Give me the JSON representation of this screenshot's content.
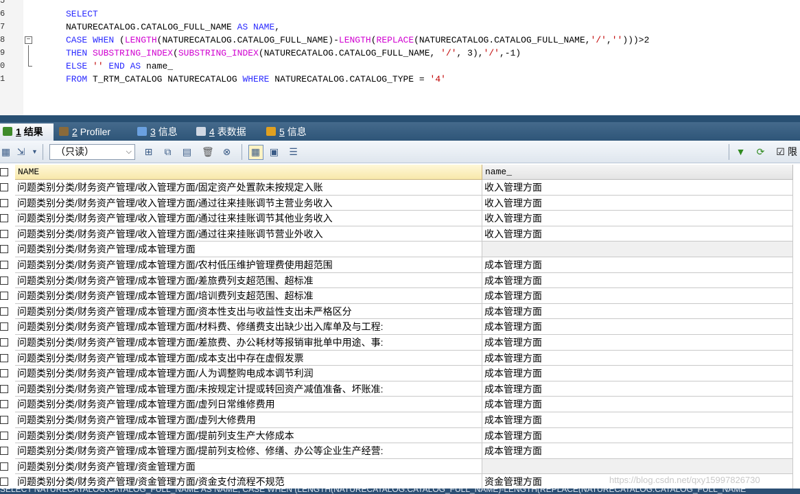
{
  "editor": {
    "lines": [
      {
        "num": "5",
        "segments": []
      },
      {
        "num": "6",
        "segments": [
          {
            "t": "SELECT",
            "c": "kw"
          }
        ]
      },
      {
        "num": "7",
        "segments": [
          {
            "t": "NATURECATALOG.CATALOG_FULL_NAME ",
            "c": "tx"
          },
          {
            "t": "AS NAME",
            "c": "kw"
          },
          {
            "t": ",",
            "c": "tx"
          }
        ]
      },
      {
        "num": "8",
        "fold": "−",
        "segments": [
          {
            "t": "CASE WHEN ",
            "c": "kw"
          },
          {
            "t": "(",
            "c": "tx"
          },
          {
            "t": "LENGTH",
            "c": "fn"
          },
          {
            "t": "(NATURECATALOG.CATALOG_FULL_NAME)-",
            "c": "tx"
          },
          {
            "t": "LENGTH",
            "c": "fn"
          },
          {
            "t": "(",
            "c": "tx"
          },
          {
            "t": "REPLACE",
            "c": "fn"
          },
          {
            "t": "(NATURECATALOG.CATALOG_FULL_NAME,",
            "c": "tx"
          },
          {
            "t": "'/'",
            "c": "st"
          },
          {
            "t": ",",
            "c": "tx"
          },
          {
            "t": "''",
            "c": "st"
          },
          {
            "t": ")))>2",
            "c": "tx"
          }
        ]
      },
      {
        "num": "9",
        "segments": [
          {
            "t": "THEN ",
            "c": "kw"
          },
          {
            "t": "SUBSTRING_INDEX",
            "c": "fn"
          },
          {
            "t": "(",
            "c": "tx"
          },
          {
            "t": "SUBSTRING_INDEX",
            "c": "fn"
          },
          {
            "t": "(NATURECATALOG.CATALOG_FULL_NAME, ",
            "c": "tx"
          },
          {
            "t": "'/'",
            "c": "st"
          },
          {
            "t": ", 3),",
            "c": "tx"
          },
          {
            "t": "'/'",
            "c": "st"
          },
          {
            "t": ",-1)",
            "c": "tx"
          }
        ]
      },
      {
        "num": "0",
        "segments": [
          {
            "t": "ELSE ",
            "c": "kw"
          },
          {
            "t": "''",
            "c": "st"
          },
          {
            "t": " END AS ",
            "c": "kw"
          },
          {
            "t": "name_",
            "c": "tx"
          }
        ]
      },
      {
        "num": "1",
        "segments": [
          {
            "t": "FROM ",
            "c": "kw"
          },
          {
            "t": "T_RTM_CATALOG NATURECATALOG ",
            "c": "tx"
          },
          {
            "t": "WHERE ",
            "c": "kw"
          },
          {
            "t": "NATURECATALOG.CATALOG_TYPE = ",
            "c": "tx"
          },
          {
            "t": "'4'",
            "c": "st"
          }
        ]
      }
    ]
  },
  "tabs": [
    {
      "num": "1",
      "label": "结果",
      "icon": "result-grid-icon",
      "active": true
    },
    {
      "num": "2",
      "label": "Profiler",
      "icon": "profiler-icon",
      "active": false
    },
    {
      "num": "3",
      "label": "信息",
      "icon": "info-icon",
      "active": false
    },
    {
      "num": "4",
      "label": "表数据",
      "icon": "table-data-icon",
      "active": false
    },
    {
      "num": "5",
      "label": "信息",
      "icon": "info-chart-icon",
      "active": false
    }
  ],
  "toolbar": {
    "readonly_select": "（只读）",
    "limit_label": "限",
    "limit_checked": true
  },
  "grid": {
    "headers": [
      "NAME",
      "name_"
    ],
    "rows": [
      [
        "问题类别分类/财务资产管理/收入管理方面/固定资产处置款未按规定入账",
        "收入管理方面"
      ],
      [
        "问题类别分类/财务资产管理/收入管理方面/通过往来挂账调节主营业务收入",
        "收入管理方面"
      ],
      [
        "问题类别分类/财务资产管理/收入管理方面/通过往来挂账调节其他业务收入",
        "收入管理方面"
      ],
      [
        "问题类别分类/财务资产管理/收入管理方面/通过往来挂账调节营业外收入",
        "收入管理方面"
      ],
      [
        "问题类别分类/财务资产管理/成本管理方面",
        ""
      ],
      [
        "问题类别分类/财务资产管理/成本管理方面/农村低压维护管理费使用超范围",
        "成本管理方面"
      ],
      [
        "问题类别分类/财务资产管理/成本管理方面/差旅费列支超范围、超标准",
        "成本管理方面"
      ],
      [
        "问题类别分类/财务资产管理/成本管理方面/培训费列支超范围、超标准",
        "成本管理方面"
      ],
      [
        "问题类别分类/财务资产管理/成本管理方面/资本性支出与收益性支出未严格区分",
        "成本管理方面"
      ],
      [
        "问题类别分类/财务资产管理/成本管理方面/材料费、修缮费支出缺少出入库单及与工程:",
        "成本管理方面"
      ],
      [
        "问题类别分类/财务资产管理/成本管理方面/差旅费、办公耗材等报销审批单中用途、事:",
        "成本管理方面"
      ],
      [
        "问题类别分类/财务资产管理/成本管理方面/成本支出中存在虚假发票",
        "成本管理方面"
      ],
      [
        "问题类别分类/财务资产管理/成本管理方面/人为调整购电成本调节利润",
        "成本管理方面"
      ],
      [
        "问题类别分类/财务资产管理/成本管理方面/未按规定计提或转回资产减值准备、坏账准:",
        "成本管理方面"
      ],
      [
        "问题类别分类/财务资产管理/成本管理方面/虚列日常维修费用",
        "成本管理方面"
      ],
      [
        "问题类别分类/财务资产管理/成本管理方面/虚列大修费用",
        "成本管理方面"
      ],
      [
        "问题类别分类/财务资产管理/成本管理方面/提前列支生产大修成本",
        "成本管理方面"
      ],
      [
        "问题类别分类/财务资产管理/成本管理方面/提前列支检修、修缮、办公等企业生产经营:",
        "成本管理方面"
      ],
      [
        "问题类别分类/财务资产管理/资金管理方面",
        ""
      ],
      [
        "问题类别分类/财务资产管理/资金管理方面/资金支付流程不规范",
        "资金管理方面"
      ]
    ]
  },
  "watermark": "https://blog.csdn.net/qxy15997826730",
  "status_text": "SELECT NATURECATALOG.CATALOG_FULL_NAME AS NAME, CASE WHEN (LENGTH(NATURECATALOG.CATALOG_FULL_NAME)-LENGTH(REPLACE(NATURECATALOG.CATALOG_FULL_NAME"
}
